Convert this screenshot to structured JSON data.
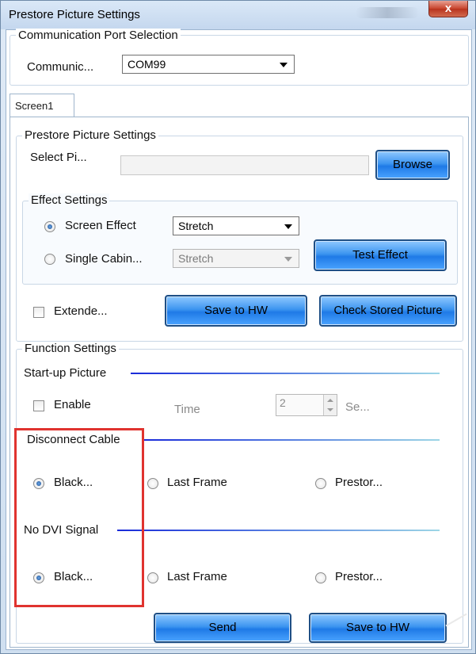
{
  "window": {
    "title": "Prestore Picture Settings",
    "close_label": "x"
  },
  "comm": {
    "legend": "Communication Port Selection",
    "port_label": "Communic...",
    "port_value": "COM99"
  },
  "tabs": [
    {
      "label": "Screen1"
    }
  ],
  "prestore": {
    "legend": "Prestore Picture Settings",
    "select_label": "Select Pi...",
    "path_value": "",
    "browse_label": "Browse",
    "effect": {
      "legend": "Effect Settings",
      "screen_effect_label": "Screen Effect",
      "screen_effect_value": "Stretch",
      "single_cabinet_label": "Single Cabin...",
      "single_cabinet_value": "Stretch",
      "test_effect_label": "Test Effect"
    },
    "extended_label": "Extende...",
    "save_hw_label": "Save to HW",
    "check_stored_label": "Check Stored Picture"
  },
  "function": {
    "legend": "Function Settings",
    "startup": {
      "heading": "Start-up Picture",
      "enable_label": "Enable",
      "time_label": "Time",
      "time_value": "2",
      "unit_label": "Se..."
    },
    "disconnect": {
      "heading": "Disconnect Cable",
      "options": [
        "Black...",
        "Last Frame",
        "Prestor..."
      ],
      "selected": 0
    },
    "no_dvi": {
      "heading": "No DVI Signal",
      "options": [
        "Black...",
        "Last Frame",
        "Prestor..."
      ],
      "selected": 0
    }
  },
  "footer": {
    "send_label": "Send",
    "save_hw_label": "Save to HW"
  },
  "colors": {
    "button_blue": "#3d95f0",
    "highlight_red": "#e0332f",
    "divider_blue": "#1a2bd9"
  }
}
